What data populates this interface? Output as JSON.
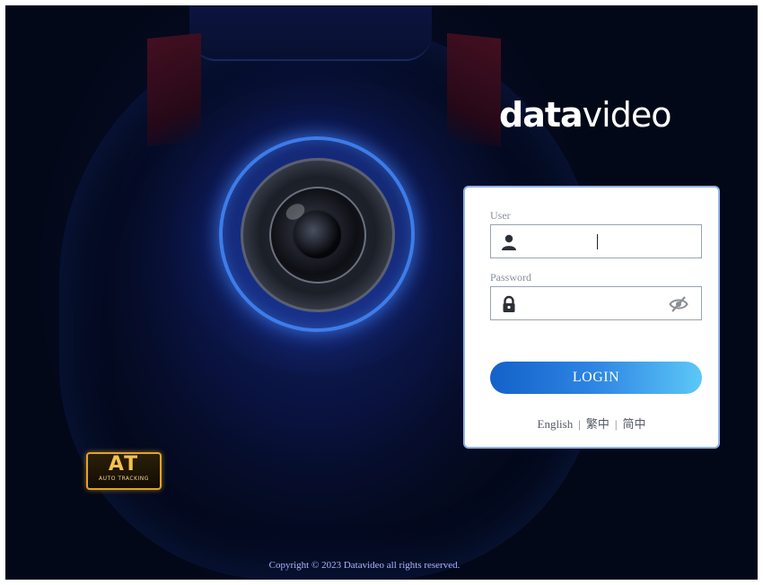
{
  "brand": {
    "part1": "data",
    "part2": "video"
  },
  "badge": {
    "big": "AT",
    "small": "AUTO TRACKING"
  },
  "login": {
    "user_label": "User",
    "user_value": "",
    "password_label": "Password",
    "password_value": "",
    "button_label": "LOGIN"
  },
  "languages": [
    "English",
    "繁中",
    "简中"
  ],
  "footer": {
    "copyright": "Copyright © 2023 Datavideo all rights reserved."
  },
  "colors": {
    "accent_start": "#1361c9",
    "accent_end": "#5cc8f7",
    "card_border": "#8fb1e6",
    "background": "#040a20"
  },
  "icons": {
    "user": "user-icon",
    "password": "lock-icon",
    "toggle": "eye-slash-icon",
    "logo": "auto-tracking-logo"
  }
}
